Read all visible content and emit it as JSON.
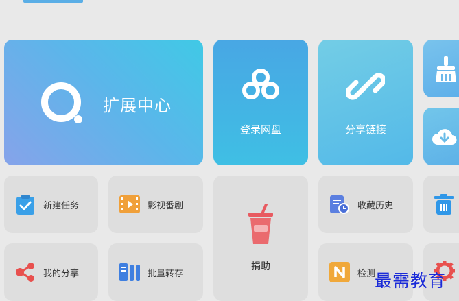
{
  "top": {
    "tab_indicator_color": "#5aaee6"
  },
  "tiles": {
    "extensions": {
      "label": "扩展中心",
      "icon": "ring-search-icon"
    },
    "login_pan": {
      "label": "登录网盘",
      "icon": "cloud-circles-icon"
    },
    "share_link": {
      "label": "分享链接",
      "icon": "chain-link-icon"
    },
    "cleanup": {
      "icon": "broom-icon"
    },
    "download": {
      "icon": "cloud-download-icon"
    },
    "new_task": {
      "label": "新建任务",
      "icon": "clipboard-check-icon",
      "color": "#3aa0e8"
    },
    "video": {
      "label": "影视番剧",
      "icon": "film-play-icon",
      "color": "#f0a03a"
    },
    "donate": {
      "label": "捐助",
      "icon": "drink-cup-icon",
      "color": "#e85a60"
    },
    "favorites": {
      "label": "收藏历史",
      "icon": "doc-clock-icon",
      "color": "#5b7fe0"
    },
    "trash": {
      "icon": "trash-icon",
      "color": "#2f97e8"
    },
    "my_share": {
      "label": "我的分享",
      "icon": "share-nodes-icon",
      "color": "#e8504e"
    },
    "batch_save": {
      "label": "批量转存",
      "icon": "batch-bars-icon",
      "color": "#3f7fe0"
    },
    "check": {
      "label": "检测",
      "icon": "n-badge-icon",
      "color": "#f0a83a"
    },
    "settings": {
      "icon": "gear-icon",
      "color": "#e8504e"
    }
  },
  "watermark": "最需教育"
}
